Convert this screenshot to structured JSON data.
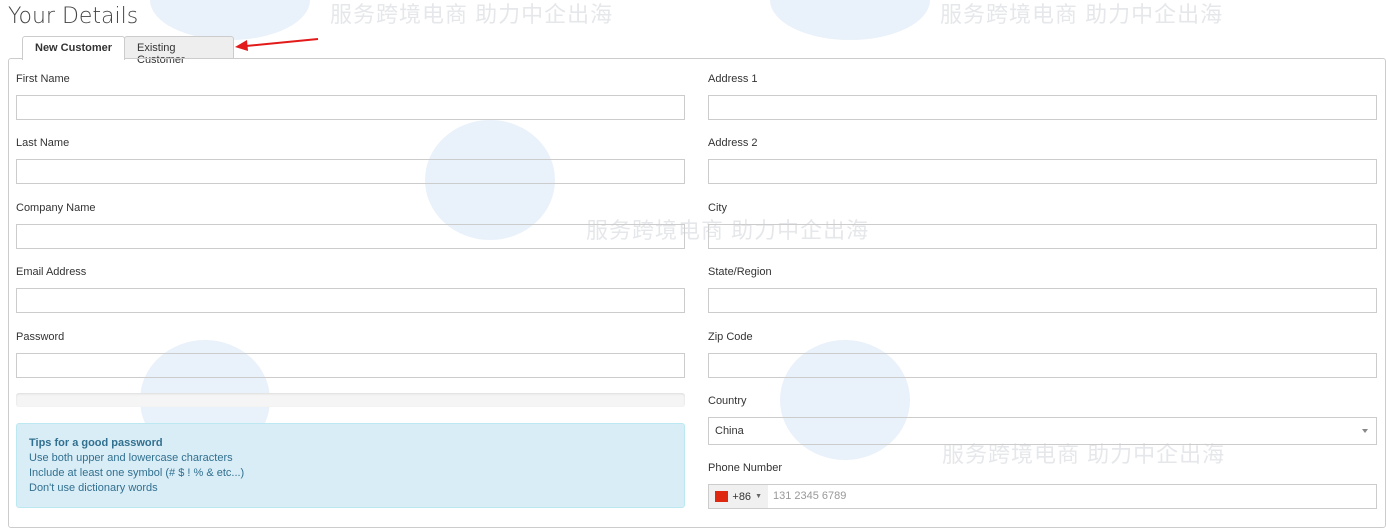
{
  "page_title": "Your Details",
  "tabs": [
    {
      "label": "New Customer",
      "active": true
    },
    {
      "label": "Existing Customer",
      "active": false
    }
  ],
  "left_fields": [
    {
      "label": "First Name",
      "value": ""
    },
    {
      "label": "Last Name",
      "value": ""
    },
    {
      "label": "Company Name",
      "value": ""
    },
    {
      "label": "Email Address",
      "value": ""
    },
    {
      "label": "Password",
      "value": ""
    }
  ],
  "right_fields": [
    {
      "label": "Address 1",
      "value": ""
    },
    {
      "label": "Address 2",
      "value": ""
    },
    {
      "label": "City",
      "value": ""
    },
    {
      "label": "State/Region",
      "value": ""
    },
    {
      "label": "Zip Code",
      "value": ""
    }
  ],
  "password_strength": 0,
  "tips": {
    "title": "Tips for a good password",
    "lines": [
      "Use both upper and lowercase characters",
      "Include at least one symbol (# $ ! % & etc...)",
      "Don't use dictionary words"
    ]
  },
  "country": {
    "label": "Country",
    "value": "China"
  },
  "phone": {
    "label": "Phone Number",
    "code": "+86",
    "placeholder": "131 2345 6789",
    "value": ""
  },
  "watermark": {
    "text": "服务跨境电商 助力中企出海"
  },
  "colors": {
    "tips_bg": "#d9edf7",
    "tips_text": "#31708f",
    "arrow": "#e31a1a"
  }
}
